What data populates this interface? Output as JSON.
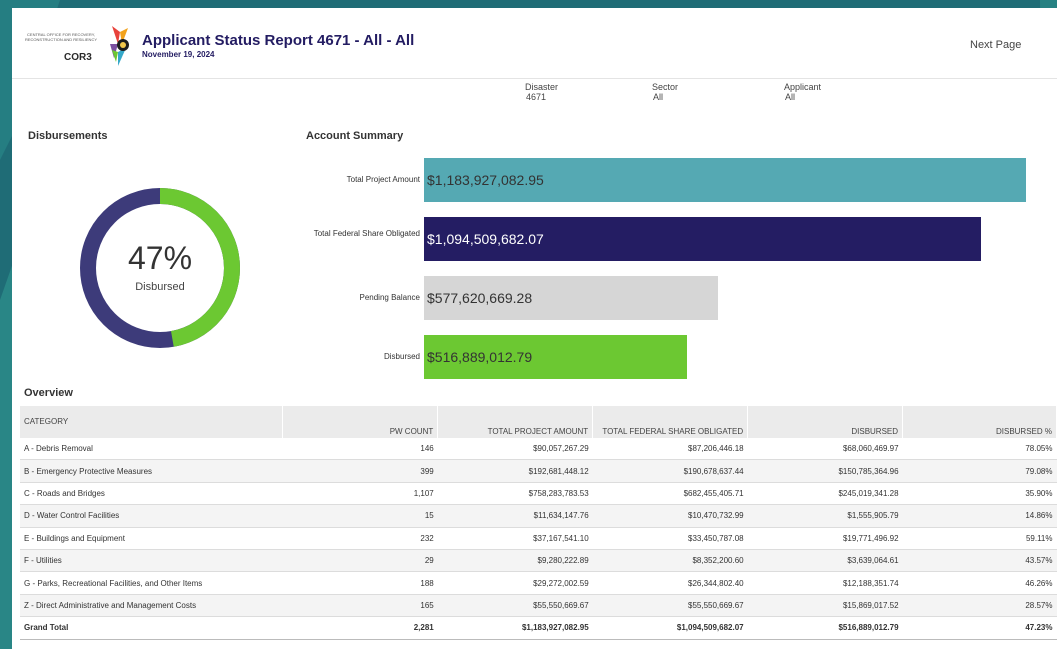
{
  "header": {
    "org_text": "Central Office for Recovery, Reconstruction and Resiliency",
    "org_name": "COR3",
    "title": "Applicant Status Report 4671 - All - All",
    "date": "November 19, 2024",
    "next_page_label": "Next Page"
  },
  "filters": [
    {
      "label": "Disaster",
      "value": "4671"
    },
    {
      "label": "Sector",
      "value": "All"
    },
    {
      "label": "Applicant",
      "value": "All"
    }
  ],
  "disbursements": {
    "title": "Disbursements",
    "percent_text": "47%",
    "caption": "Disbursed",
    "fraction": 0.4723,
    "colors": {
      "disbursed": "#6cc832",
      "remaining": "#3d3b7a"
    }
  },
  "account_summary": {
    "title": "Account Summary",
    "bars": [
      {
        "label": "Total Project Amount",
        "value_text": "$1,183,927,082.95",
        "value": 1183927082.95,
        "color": "#55a9b3",
        "text_color": "#333333"
      },
      {
        "label": "Total Federal Share Obligated",
        "value_text": "$1,094,509,682.07",
        "value": 1094509682.07,
        "color": "#241d63",
        "text_color": "#ffffff"
      },
      {
        "label": "Pending Balance",
        "value_text": "$577,620,669.28",
        "value": 577620669.28,
        "color": "#d6d6d6",
        "text_color": "#333333"
      },
      {
        "label": "Disbursed",
        "value_text": "$516,889,012.79",
        "value": 516889012.79,
        "color": "#6cc832",
        "text_color": "#333333"
      }
    ]
  },
  "overview": {
    "title": "Overview",
    "columns": [
      "CATEGORY",
      "PW COUNT",
      "TOTAL PROJECT AMOUNT",
      "TOTAL FEDERAL SHARE OBLIGATED",
      "DISBURSED",
      "DISBURSED %"
    ],
    "rows": [
      [
        "A - Debris Removal",
        "146",
        "$90,057,267.29",
        "$87,206,446.18",
        "$68,060,469.97",
        "78.05%"
      ],
      [
        "B - Emergency Protective Measures",
        "399",
        "$192,681,448.12",
        "$190,678,637.44",
        "$150,785,364.96",
        "79.08%"
      ],
      [
        "C - Roads and Bridges",
        "1,107",
        "$758,283,783.53",
        "$682,455,405.71",
        "$245,019,341.28",
        "35.90%"
      ],
      [
        "D - Water Control Facilities",
        "15",
        "$11,634,147.76",
        "$10,470,732.99",
        "$1,555,905.79",
        "14.86%"
      ],
      [
        "E - Buildings and Equipment",
        "232",
        "$37,167,541.10",
        "$33,450,787.08",
        "$19,771,496.92",
        "59.11%"
      ],
      [
        "F - Utilities",
        "29",
        "$9,280,222.89",
        "$8,352,200.60",
        "$3,639,064.61",
        "43.57%"
      ],
      [
        "G - Parks, Recreational Facilities, and Other Items",
        "188",
        "$29,272,002.59",
        "$26,344,802.40",
        "$12,188,351.74",
        "46.26%"
      ],
      [
        "Z - Direct Administrative and Management Costs",
        "165",
        "$55,550,669.67",
        "$55,550,669.67",
        "$15,869,017.52",
        "28.57%"
      ]
    ],
    "total": [
      "Grand Total",
      "2,281",
      "$1,183,927,082.95",
      "$1,094,509,682.07",
      "$516,889,012.79",
      "47.23%"
    ]
  }
}
